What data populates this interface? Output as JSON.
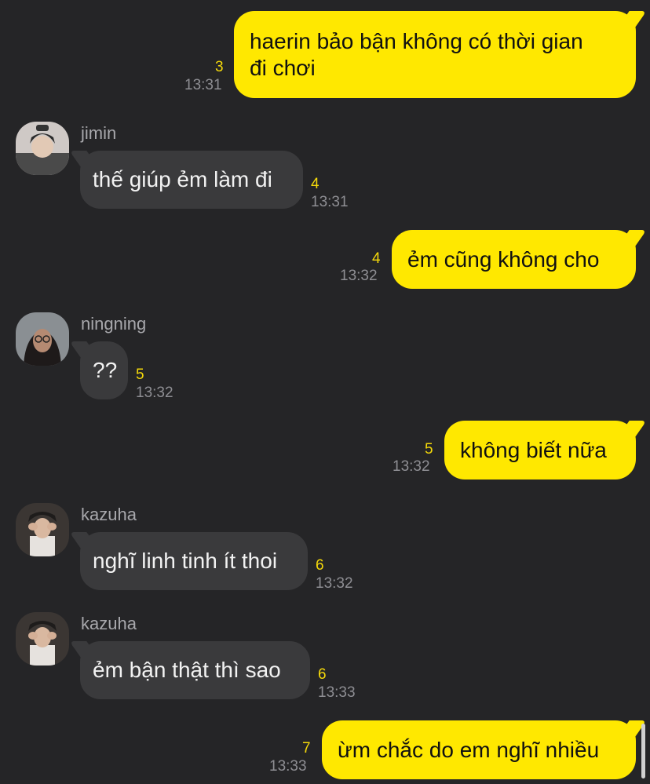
{
  "messages": [
    {
      "sender": "",
      "text_line1": "haerin bảo bận không có thời gian",
      "text_line2": "đi chơi",
      "unread": "3",
      "time": "13:31"
    },
    {
      "sender": "jimin",
      "text": "thế giúp ẻm làm đi",
      "unread": "4",
      "time": "13:31"
    },
    {
      "sender": "",
      "text": "ẻm cũng không cho",
      "unread": "4",
      "time": "13:32"
    },
    {
      "sender": "ningning",
      "text": "??",
      "unread": "5",
      "time": "13:32"
    },
    {
      "sender": "",
      "text": "không biết nữa",
      "unread": "5",
      "time": "13:32"
    },
    {
      "sender": "kazuha",
      "text": "nghĩ linh tinh ít thoi",
      "unread": "6",
      "time": "13:32"
    },
    {
      "sender": "kazuha",
      "text": "ẻm bận thật thì sao",
      "unread": "6",
      "time": "13:33"
    },
    {
      "sender": "",
      "text": "ừm chắc do em nghĩ nhiều",
      "unread": "7",
      "time": "13:33"
    }
  ],
  "colors": {
    "outgoing": "#FFE800",
    "incoming": "#3A3A3C",
    "background": "#252527",
    "unread": "#F5D90A"
  }
}
